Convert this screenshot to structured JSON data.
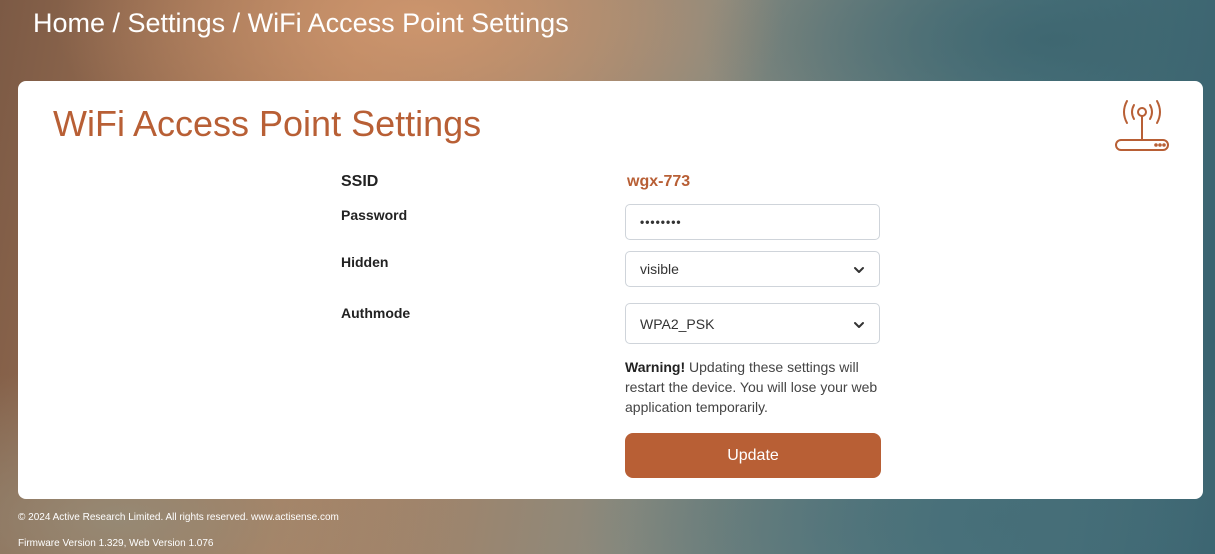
{
  "breadcrumb": "Home / Settings / WiFi Access Point Settings",
  "page": {
    "title": "WiFi Access Point Settings",
    "icon": "wifi-router-icon"
  },
  "form": {
    "ssid_label": "SSID",
    "ssid_value": "wgx-773",
    "password_label": "Password",
    "password_value": "••••••••",
    "hidden_label": "Hidden",
    "hidden_value": "visible",
    "authmode_label": "Authmode",
    "authmode_value": "WPA2_PSK",
    "warning_strong": "Warning!",
    "warning_text": " Updating these settings will restart the device. You will lose your web application temporarily.",
    "update_label": "Update"
  },
  "footer": {
    "copyright": "© 2024 Active Research Limited. All rights reserved.  www.actisense.com",
    "firmware": "Firmware Version 1.329, Web Version 1.076"
  },
  "colors": {
    "accent": "#b85f35",
    "card_background": "#ffffff"
  }
}
